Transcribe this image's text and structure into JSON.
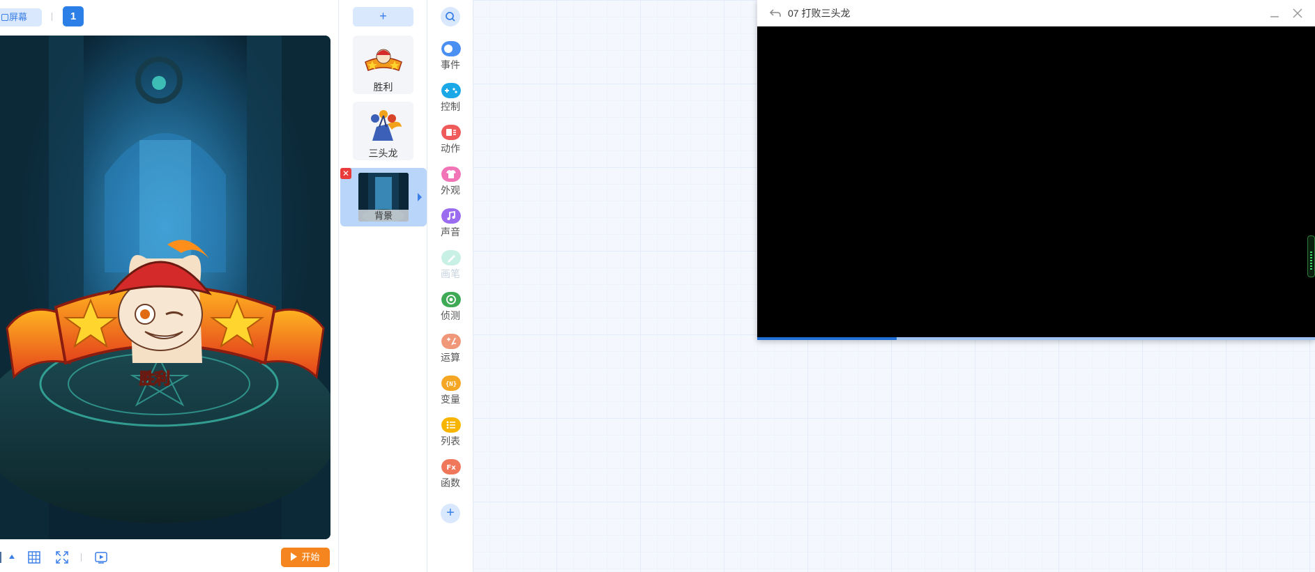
{
  "stage_toolbar": {
    "screen_label": "屏幕",
    "page_number": "1"
  },
  "stage_bottom": {
    "start_label": "开始"
  },
  "stage_scene": {
    "banner_text": "胜利"
  },
  "sprites": {
    "add_label": "+",
    "items": [
      {
        "label": "胜利",
        "icon": "victory-sprite-icon"
      },
      {
        "label": "三头龙",
        "icon": "dragon-sprite-icon"
      },
      {
        "label": "背景",
        "icon": "background-sprite-icon",
        "selected": true
      }
    ]
  },
  "categories": {
    "items": [
      {
        "label": "事件",
        "color": "#4a8ff2",
        "icon": "toggle-icon"
      },
      {
        "label": "控制",
        "color": "#1aa8e6",
        "icon": "gamepad-icon"
      },
      {
        "label": "动作",
        "color": "#ef5a5a",
        "icon": "motion-icon"
      },
      {
        "label": "外观",
        "color": "#f174b6",
        "icon": "shirt-icon"
      },
      {
        "label": "声音",
        "color": "#9b6cf0",
        "icon": "music-note-icon"
      },
      {
        "label": "画笔",
        "color": "#c8f0e4",
        "icon": "pen-icon",
        "dim": true
      },
      {
        "label": "侦测",
        "color": "#3eaa55",
        "icon": "sensing-icon"
      },
      {
        "label": "运算",
        "color": "#f0977a",
        "icon": "operators-icon"
      },
      {
        "label": "变量",
        "color": "#f5a623",
        "icon": "variable-icon",
        "text": "{N}"
      },
      {
        "label": "列表",
        "color": "#f7b500",
        "icon": "list-icon"
      },
      {
        "label": "函数",
        "color": "#f0775a",
        "icon": "function-icon",
        "text": "Fx"
      }
    ],
    "add_label": "+"
  },
  "video_window": {
    "title": "07 打败三头龙",
    "progress": 0.25
  },
  "colors": {
    "accent": "#2d7fe8",
    "start": "#f5861f",
    "workspace": "#f4f8fe"
  }
}
